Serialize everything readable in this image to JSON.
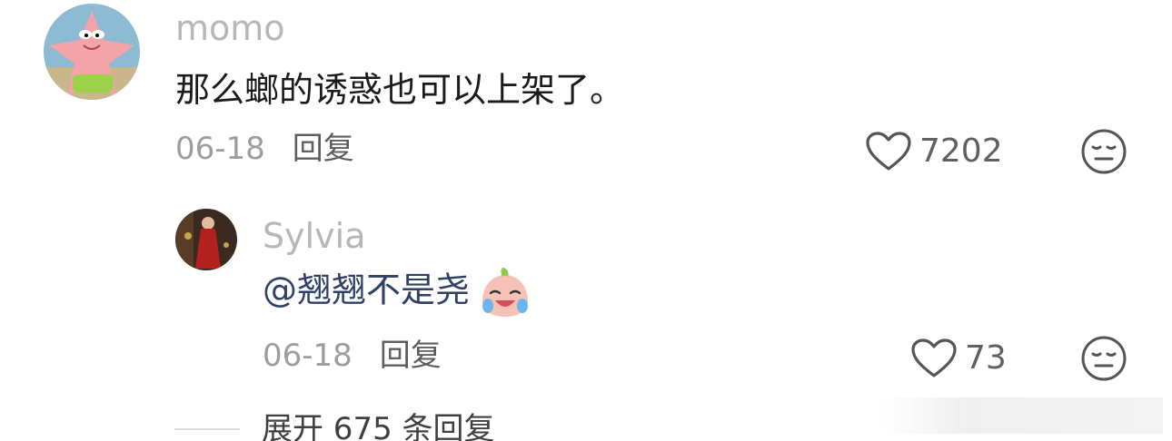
{
  "comment": {
    "avatar": "patrick-star-avatar",
    "username": "momo",
    "text": "那么螂的诱惑也可以上架了。",
    "date": "06-18",
    "reply_label": "回复",
    "like_icon": "heart-outline-icon",
    "like_count": "7202",
    "dislike_icon": "meh-face-icon"
  },
  "reply": {
    "avatar": "woman-in-red-avatar",
    "username": "Sylvia",
    "mention": "@翘翘不是尧",
    "emoji": "crying-laughing-emoji",
    "date": "06-18",
    "reply_label": "回复",
    "like_icon": "heart-outline-icon",
    "like_count": "73",
    "dislike_icon": "meh-face-icon"
  },
  "expand": {
    "label": "展开 675 条回复"
  },
  "colors": {
    "username": "#b7b7b9",
    "text": "#1b1b1c",
    "mention": "#2f3f66",
    "meta": "#9d9d9f"
  }
}
